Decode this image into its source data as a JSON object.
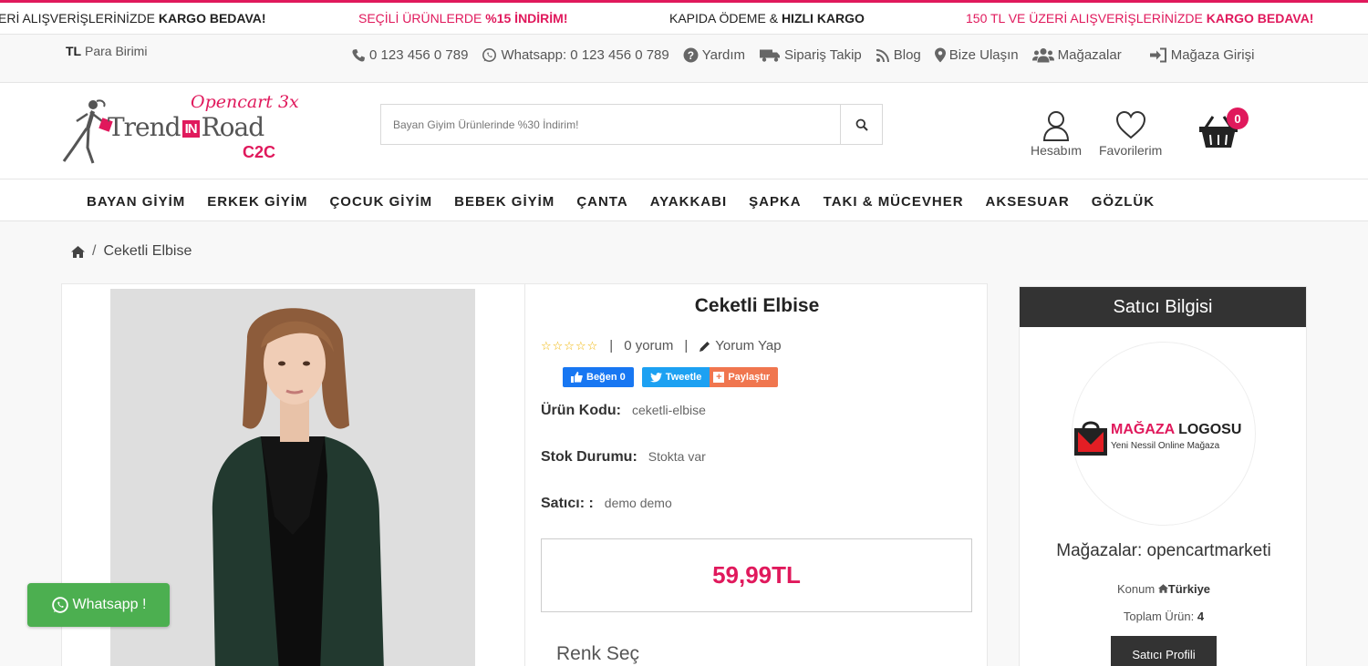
{
  "promo": {
    "p1_text": "ERİ ALIŞVERİŞLERİNİZDE ",
    "p1_bold": "KARGO BEDAVA!",
    "p2_text": "SEÇİLİ ÜRÜNLERDE ",
    "p2_bold": "%15 İNDİRİM!",
    "p3_text": "KAPIDA ÖDEME & ",
    "p3_bold": "HIZLI KARGO",
    "p4_text": "150 TL VE ÜZERİ ALIŞVERİŞLERİNİZDE ",
    "p4_bold": "KARGO BEDAVA!"
  },
  "util": {
    "currency_code": "TL",
    "currency_label": "Para Birimi",
    "phone": "0 123 456 0 789",
    "whatsapp": "Whatsapp: 0 123 456 0 789",
    "help": "Yardım",
    "order_track": "Sipariş Takip",
    "blog": "Blog",
    "contact": "Bize Ulaşın",
    "stores": "Mağazalar",
    "store_login": "Mağaza Girişi"
  },
  "header": {
    "logo_top": "Opencart 3x",
    "logo_trend": "Trend",
    "logo_in": "IN",
    "logo_road": "Road",
    "logo_c2c": "C2C",
    "search_placeholder": "Bayan Giyim Ürünlerinde %30 İndirim!",
    "account": "Hesabım",
    "favorites": "Favorilerim",
    "cart_count": "0"
  },
  "nav": [
    "BAYAN GİYİM",
    "ERKEK GİYİM",
    "ÇOCUK GİYİM",
    "BEBEK GİYİM",
    "ÇANTA",
    "AYAKKABI",
    "ŞAPKA",
    "TAKI & MÜCEVHER",
    "AKSESUAR",
    "GÖZLÜK"
  ],
  "breadcrumb": {
    "current": "Ceketli Elbise"
  },
  "product": {
    "title": "Ceketli Elbise",
    "stars": "☆☆☆☆☆",
    "reviews": "0 yorum",
    "write_review": "Yorum Yap",
    "fb_like": "Beğen 0",
    "tweet": "Tweetle",
    "share": "Paylaştır",
    "code_label": "Ürün Kodu:",
    "code_value": "ceketli-elbise",
    "stock_label": "Stok Durumu:",
    "stock_value": "Stokta var",
    "seller_label": "Satıcı: :",
    "seller_value": "demo demo",
    "price": "59,99TL",
    "color_label": "Renk Seç"
  },
  "seller": {
    "heading": "Satıcı Bilgisi",
    "logo_main": "MAĞAZA ",
    "logo_main2": "LOGOSU",
    "logo_sub": "Yeni Nessil Online Mağaza",
    "store_name": "Mağazalar: opencartmarketi",
    "location_label": "Konum",
    "location_value": "Türkiye",
    "total_label": "Toplam Ürün:",
    "total_value": "4",
    "profile_button": "Satıcı Profili"
  },
  "whatsapp_button": "Whatsapp !",
  "colors": {
    "accent": "#e0195c",
    "dark": "#333333",
    "whatsapp": "#4caf50"
  }
}
